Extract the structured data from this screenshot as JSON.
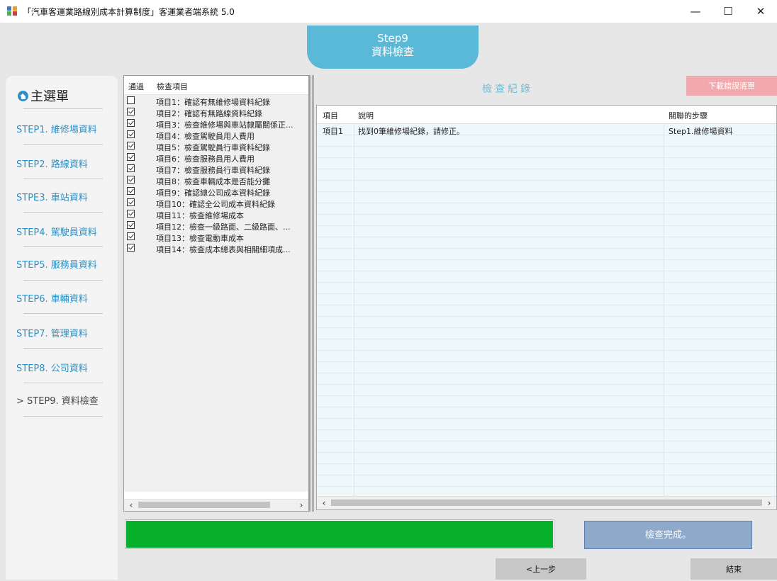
{
  "window": {
    "title": "「汽車客運業路線別成本計算制度」客運業者端系統 5.0",
    "minimize_glyph": "—",
    "maximize_glyph": "☐",
    "close_glyph": "✕",
    "icon": "app-icon"
  },
  "step_header": {
    "line1": "Step9",
    "line2": "資料檢查",
    "color": "#5bb9d8"
  },
  "sidebar": {
    "title": "主選單",
    "title_icon": "home-icon",
    "items": [
      {
        "label": "STEP1. 維修場資料",
        "active": false
      },
      {
        "label": "STEP2. 路線資料",
        "active": false
      },
      {
        "label": "STPE3. 車站資料",
        "active": false
      },
      {
        "label": "STEP4. 駕駛員資料",
        "active": false
      },
      {
        "label": "STEP5. 服務員資料",
        "active": false
      },
      {
        "label": "STEP6. 車輛資料",
        "active": false
      },
      {
        "label": "STEP7. 管理資料",
        "active": false
      },
      {
        "label": "STEP8. 公司資料",
        "active": false
      },
      {
        "label": "> STEP9. 資料檢查",
        "active": true
      }
    ]
  },
  "check_list": {
    "columns": {
      "pass": "通過",
      "item": "檢查項目"
    },
    "items": [
      {
        "checked": false,
        "label": "項目1：確認有無維修場資料紀錄"
      },
      {
        "checked": true,
        "label": "項目2：確認有無路線資料紀錄"
      },
      {
        "checked": true,
        "label": "項目3：檢查維修場與車站隸屬關係正..."
      },
      {
        "checked": true,
        "label": "項目4：檢查駕駛員用人費用"
      },
      {
        "checked": true,
        "label": "項目5：檢查駕駛員行車資料紀錄"
      },
      {
        "checked": true,
        "label": "項目6：檢查服務員用人費用"
      },
      {
        "checked": true,
        "label": "項目7：檢查服務員行車資料紀錄"
      },
      {
        "checked": true,
        "label": "項目8：檢查車輛成本是否能分攤"
      },
      {
        "checked": true,
        "label": "項目9：確認總公司成本資料紀錄"
      },
      {
        "checked": true,
        "label": "項目10：確認全公司成本資料紀錄"
      },
      {
        "checked": true,
        "label": "項目11：檢查維修場成本"
      },
      {
        "checked": true,
        "label": "項目12：檢查一級路面、二級路面、..."
      },
      {
        "checked": true,
        "label": "項目13：檢查電動車成本"
      },
      {
        "checked": true,
        "label": "項目14：檢查成本總表與相關細項成..."
      }
    ],
    "scroll_left": "‹",
    "scroll_right": "›"
  },
  "log": {
    "title": "檢查紀錄",
    "download_button": "下載錯誤清單",
    "download_color": "#f2a9ad",
    "columns": {
      "item": "項目",
      "desc": "說明",
      "step": "關聯的步驟"
    },
    "rows": [
      {
        "item": "項目1",
        "desc": "找到0筆維修場紀錄，請修正。",
        "step": "Step1.維修場資料"
      }
    ],
    "scroll_left": "‹",
    "scroll_right": "›"
  },
  "progress": {
    "value": 1.0,
    "color": "#06b02b"
  },
  "status_button": "檢查完成。",
  "prev_button": "<上一步",
  "end_button": "結束"
}
